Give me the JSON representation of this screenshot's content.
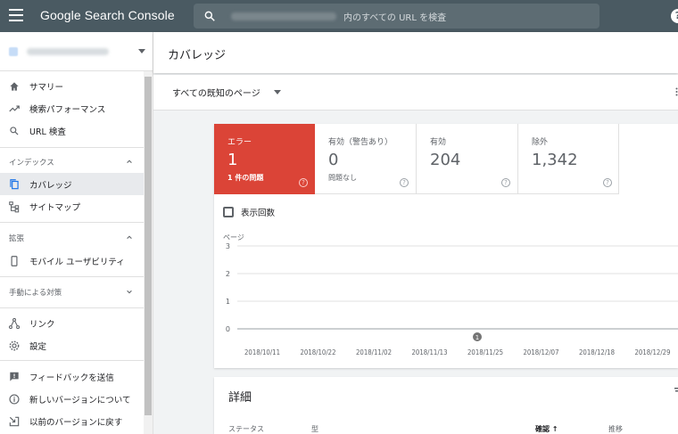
{
  "app": {
    "title": "Google Search Console",
    "search_placeholder": "内のすべての URL を検査"
  },
  "sidebar": {
    "items": [
      {
        "label": "サマリー",
        "icon": "home-icon"
      },
      {
        "label": "検索パフォーマンス",
        "icon": "trending-up-icon"
      },
      {
        "label": "URL 検査",
        "icon": "search-icon"
      }
    ],
    "sections": [
      {
        "label": "インデックス",
        "items": [
          {
            "label": "カバレッジ",
            "icon": "file-copy-icon",
            "active": true
          },
          {
            "label": "サイトマップ",
            "icon": "sitemap-icon"
          }
        ]
      },
      {
        "label": "拡張",
        "items": [
          {
            "label": "モバイル ユーザビリティ",
            "icon": "smartphone-icon"
          }
        ]
      },
      {
        "label": "手動による対策",
        "items": []
      }
    ],
    "bottom_items": [
      {
        "label": "リンク",
        "icon": "links-icon"
      },
      {
        "label": "設定",
        "icon": "gear-icon"
      },
      {
        "label": "フィードバックを送信",
        "icon": "feedback-icon"
      },
      {
        "label": "新しいバージョンについて",
        "icon": "info-icon"
      },
      {
        "label": "以前のバージョンに戻す",
        "icon": "exit-icon"
      }
    ]
  },
  "page": {
    "title": "カバレッジ",
    "filter": "すべての既知のページ"
  },
  "tiles": [
    {
      "label": "エラー",
      "value": "1",
      "sub": "1 件の問題",
      "active": true,
      "color": "#db4437"
    },
    {
      "label": "有効（警告あり）",
      "value": "0",
      "sub": "問題なし"
    },
    {
      "label": "有効",
      "value": "204",
      "sub": ""
    },
    {
      "label": "除外",
      "value": "1,342",
      "sub": ""
    }
  ],
  "checkbox_label": "表示回数",
  "chart_data": {
    "type": "bar",
    "ylabel": "ページ",
    "ylim": [
      0,
      3
    ],
    "yticks": [
      "3",
      "2",
      "1",
      "0"
    ],
    "xticks": [
      "2018/10/11",
      "2018/10/22",
      "2018/11/02",
      "2018/11/13",
      "2018/11/25",
      "2018/12/07",
      "2018/12/18",
      "2018/12/29"
    ],
    "series": [
      {
        "values": [
          0,
          0,
          0,
          0,
          0,
          0,
          0,
          0,
          0,
          0,
          0,
          0,
          0,
          0,
          0,
          0,
          0,
          0,
          0,
          0,
          0,
          0,
          0,
          0,
          0,
          0,
          0,
          0,
          0,
          0,
          0,
          0,
          0,
          0,
          0,
          0,
          0,
          0,
          0,
          0,
          0,
          0,
          0,
          0,
          0,
          0,
          0,
          0,
          0,
          0,
          0,
          0,
          0,
          0,
          0,
          0,
          0,
          0,
          0,
          0,
          0,
          0,
          0,
          0,
          0,
          0,
          0,
          0,
          0,
          0,
          0,
          0,
          0,
          0,
          0,
          0,
          0,
          0,
          0,
          0,
          0,
          0,
          0,
          0,
          0,
          0,
          0,
          0,
          0,
          0,
          0,
          0,
          0,
          0,
          0,
          0,
          0,
          0,
          0,
          0
        ]
      }
    ],
    "bar_color": "#db4437",
    "annotation": "1"
  },
  "detail": {
    "title": "詳細",
    "columns": [
      "ステータス",
      "型",
      "確認",
      "推移"
    ]
  }
}
